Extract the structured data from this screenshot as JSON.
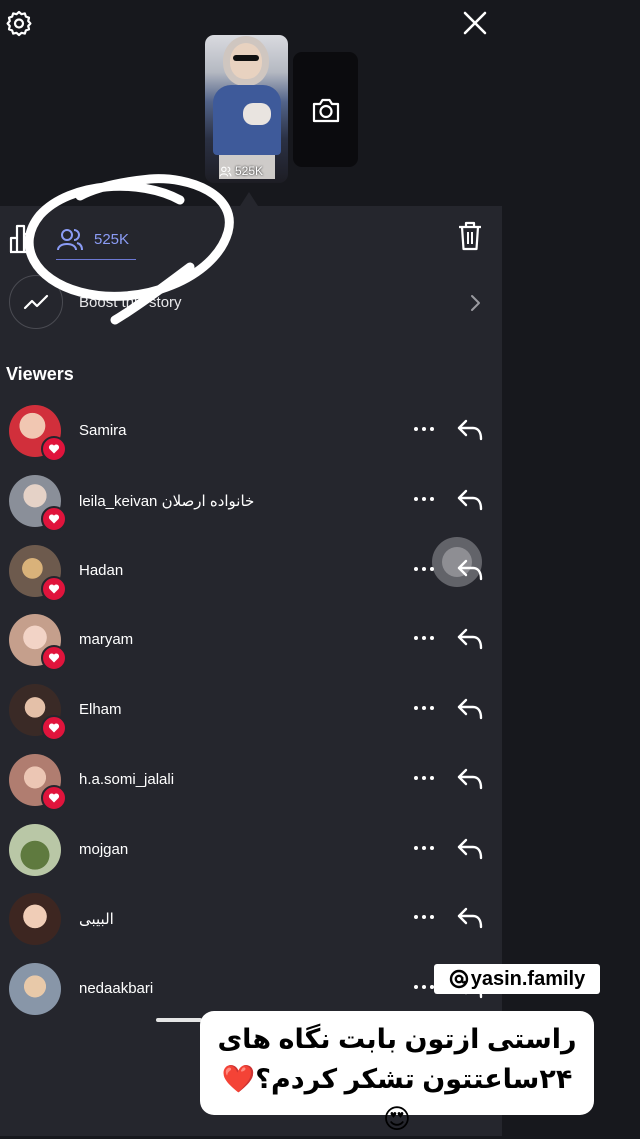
{
  "story": {
    "view_count": "525K",
    "thumb_view_count": "525K",
    "boost_label": "Boost this story",
    "viewers_heading": "Viewers"
  },
  "viewers": [
    {
      "name": "Samira",
      "liked": true
    },
    {
      "name": "leila_keivan خانواده ارصلان",
      "liked": true
    },
    {
      "name": "Hadan",
      "liked": true
    },
    {
      "name": "maryam",
      "liked": true
    },
    {
      "name": "Elham",
      "liked": true
    },
    {
      "name": "h.a.somi_jalali",
      "liked": true
    },
    {
      "name": "mojgan",
      "liked": false
    },
    {
      "name": "البیبی",
      "liked": false
    },
    {
      "name": "nedaakbari",
      "liked": false
    }
  ],
  "overlay": {
    "mention": "yasin.family",
    "caption_line1": "راستی ازتون بابت نگاه های",
    "caption_line2": "۲۴ساعتتون تشکر کردم؟❤️😍"
  },
  "colors": {
    "accent": "#8b9cf5",
    "background": "#25262d",
    "like_badge": "#e0143c"
  }
}
